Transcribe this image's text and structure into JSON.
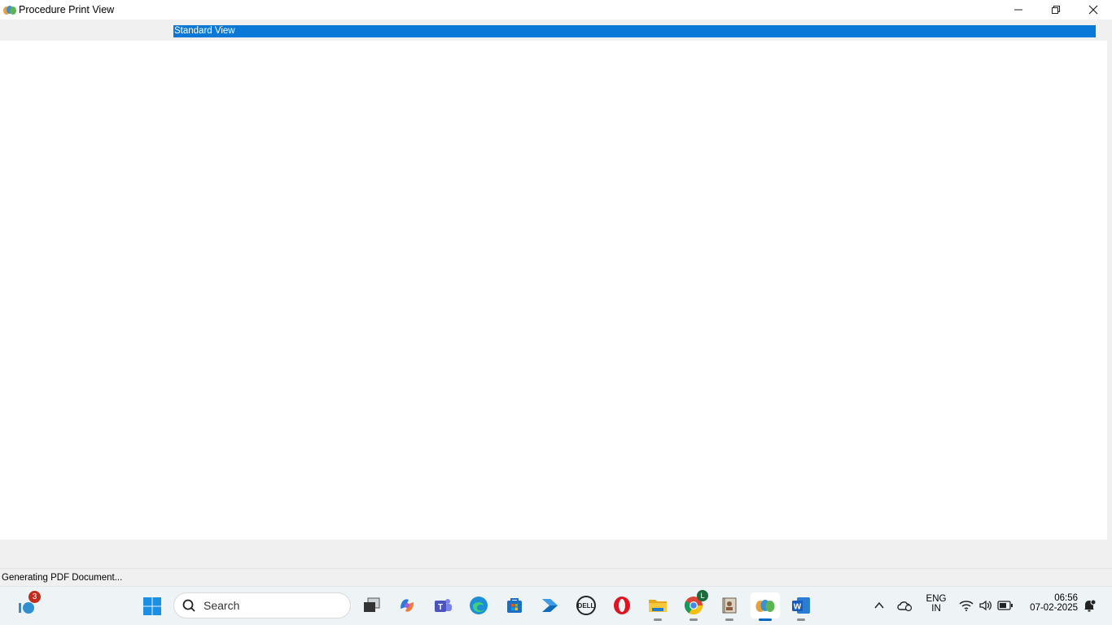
{
  "window": {
    "title": "Procedure Print View",
    "view_label": "Standard View",
    "status": "Generating PDF Document..."
  },
  "controls": {
    "minimize": "–",
    "maximize": "❐",
    "close": "✕"
  },
  "taskbar": {
    "widgets_badge": "3",
    "search_placeholder": "Search",
    "chrome_badge": "L",
    "language_line1": "ENG",
    "language_line2": "IN",
    "time": "06:56",
    "date": "07-02-2025"
  },
  "colors": {
    "selection": "#0a78d7",
    "taskbar_bg": "#eef3f6",
    "accent": "#0067c0"
  }
}
